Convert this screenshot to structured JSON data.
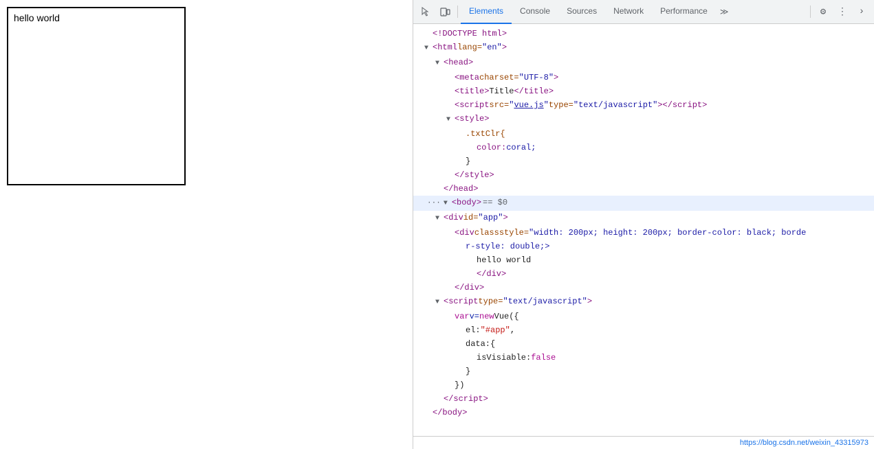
{
  "preview": {
    "text": "hello world"
  },
  "devtools": {
    "tabs": [
      {
        "id": "elements",
        "label": "Elements",
        "active": true
      },
      {
        "id": "console",
        "label": "Console",
        "active": false
      },
      {
        "id": "sources",
        "label": "Sources",
        "active": false
      },
      {
        "id": "network",
        "label": "Network",
        "active": false
      },
      {
        "id": "performance",
        "label": "Performance",
        "active": false
      }
    ],
    "toolbar": {
      "inspect_icon": "⬚",
      "device_icon": "⬒",
      "more_icon": "≫",
      "settings_icon": "⚙",
      "dots_icon": "⋮",
      "chevron_icon": "›"
    },
    "footer_url": "https://blog.csdn.net/weixin_43315973"
  }
}
